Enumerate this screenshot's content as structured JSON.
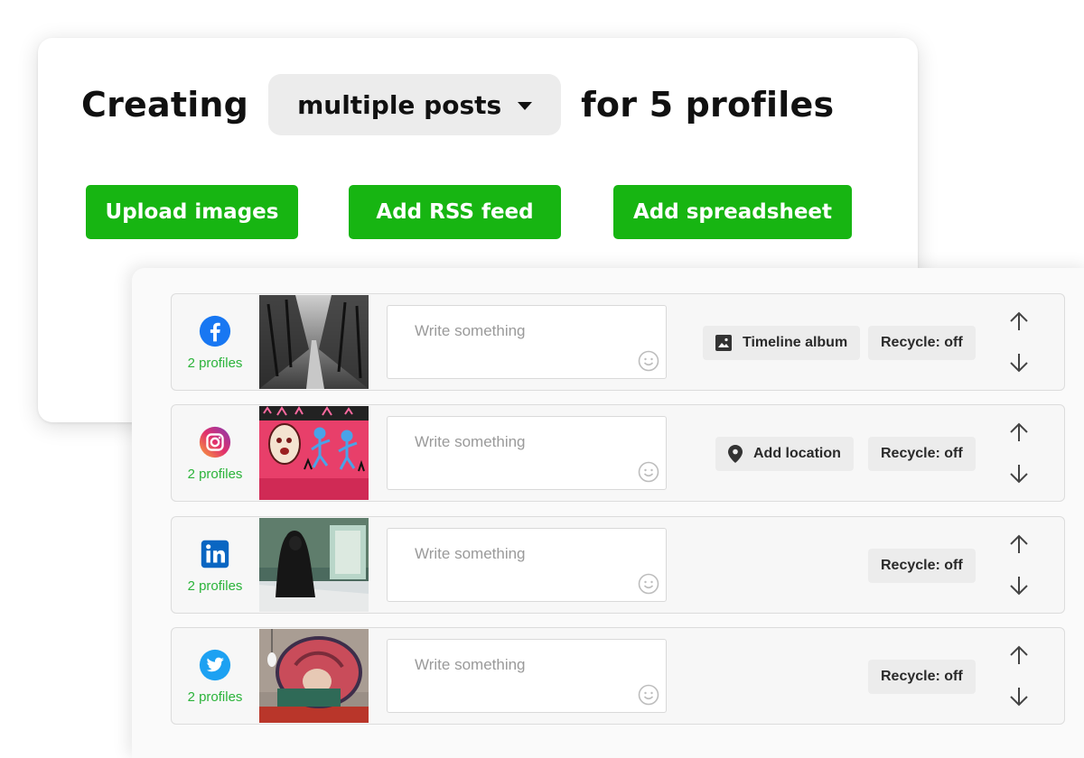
{
  "header": {
    "prefix": "Creating",
    "mode_value": "multiple posts",
    "suffix": "for 5 profiles"
  },
  "actions": {
    "upload_images": "Upload images",
    "add_rss": "Add RSS feed",
    "add_spreadsheet": "Add spreadsheet"
  },
  "colors": {
    "accent_green": "#17b512",
    "facebook": "#1877f2",
    "linkedin": "#0a66c2",
    "twitter": "#1da1f2"
  },
  "posts": [
    {
      "network": "facebook",
      "icon": "facebook-icon",
      "profiles": "2 profiles",
      "placeholder": "Write something",
      "option": "Timeline album",
      "option_icon": "photo-album-icon",
      "recycle": "Recycle: off"
    },
    {
      "network": "instagram",
      "icon": "instagram-icon",
      "profiles": "2 profiles",
      "placeholder": "Write something",
      "option": "Add location",
      "option_icon": "location-pin-icon",
      "recycle": "Recycle: off"
    },
    {
      "network": "linkedin",
      "icon": "linkedin-icon",
      "profiles": "2 profiles",
      "placeholder": "Write something",
      "recycle": "Recycle: off"
    },
    {
      "network": "twitter",
      "icon": "twitter-icon",
      "profiles": "2 profiles",
      "placeholder": "Write something",
      "recycle": "Recycle: off"
    }
  ]
}
